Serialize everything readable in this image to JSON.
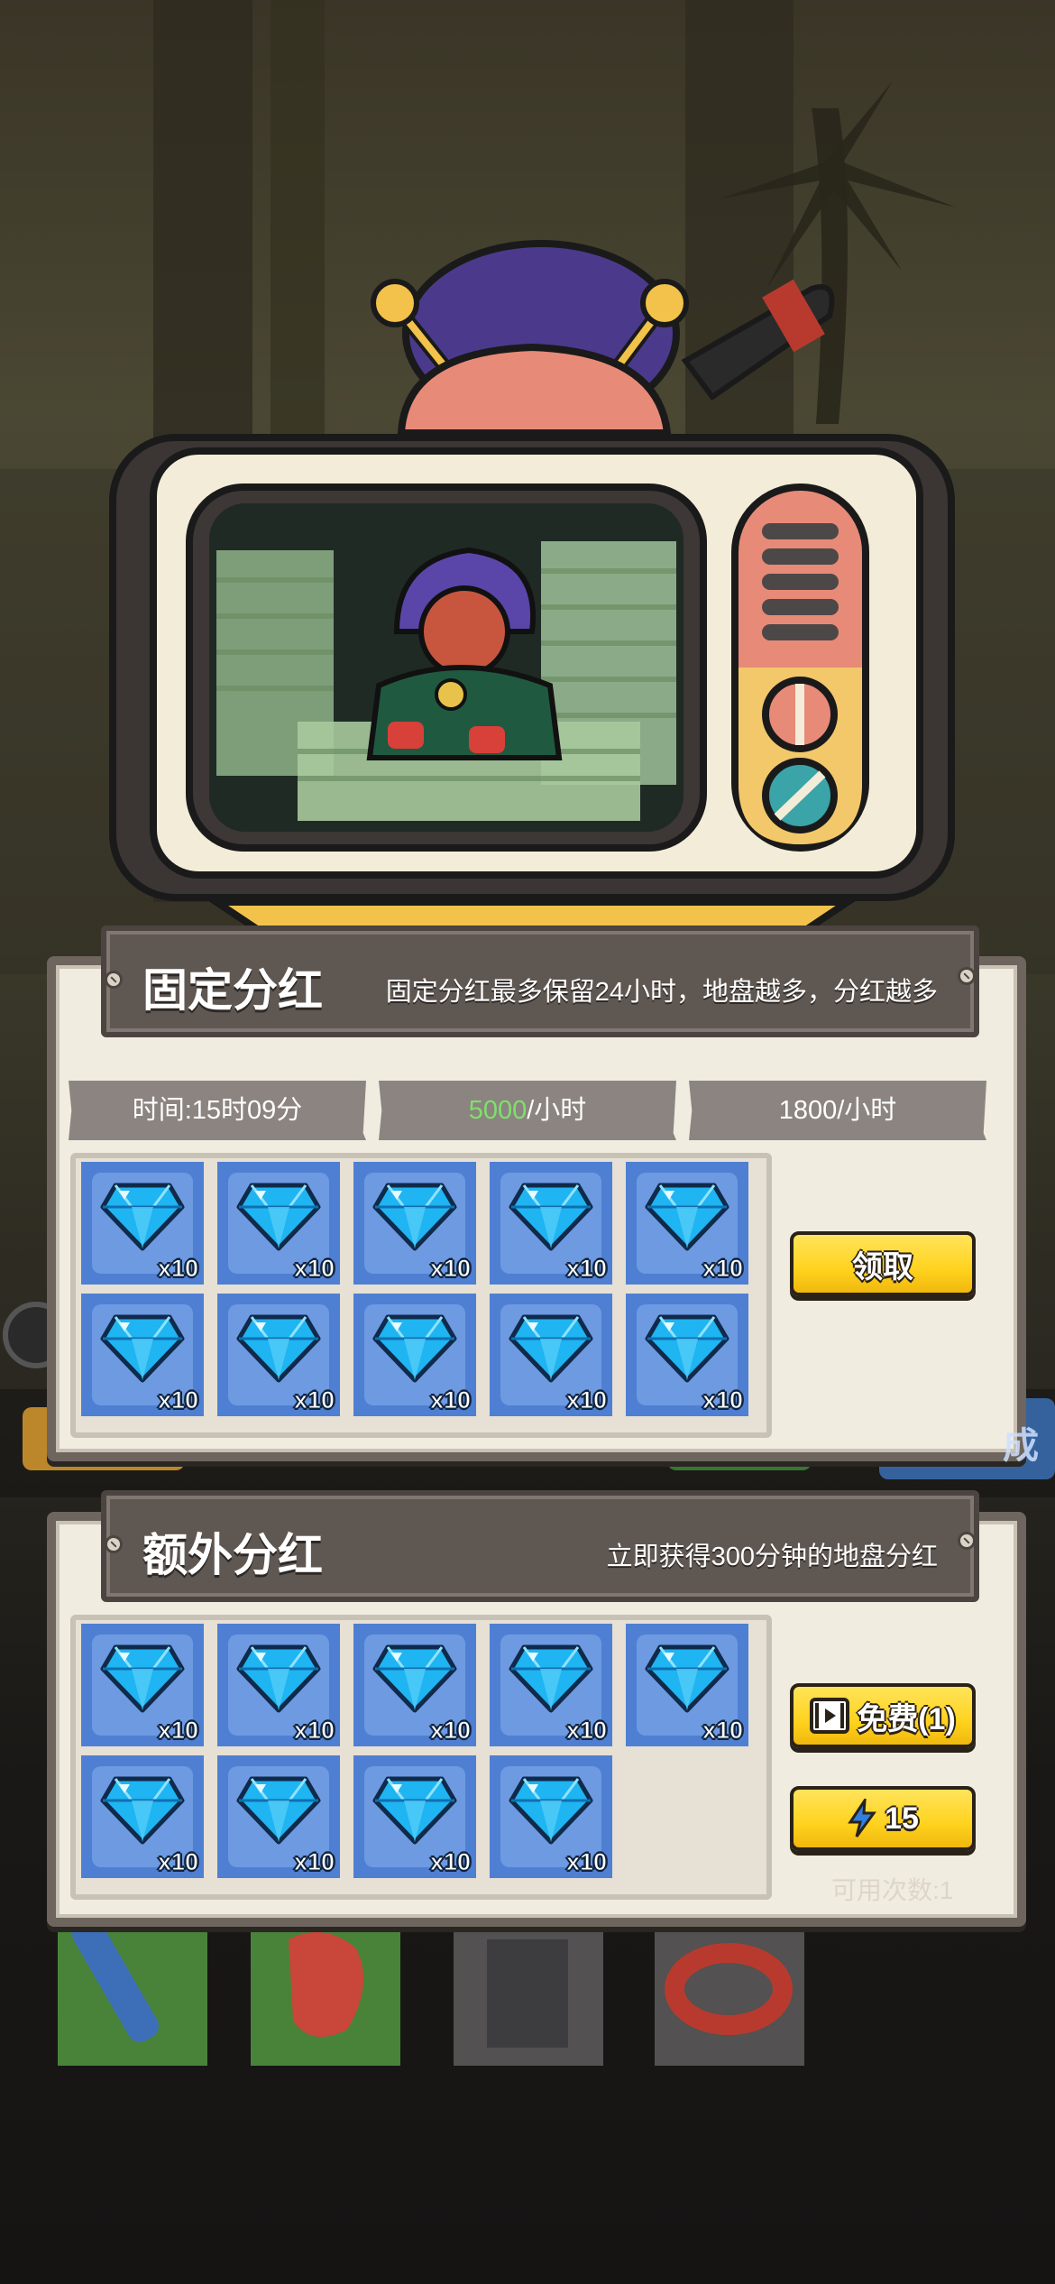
{
  "fixed_dividend": {
    "title": "固定分红",
    "description": "固定分红最多保留24小时，地盘越多，分红越多",
    "time_label": "时间:15时09分",
    "rate_value": "5000",
    "rate_unit": "/小时",
    "bonus_rate": "1800/小时",
    "rewards": [
      {
        "icon": "diamond-icon",
        "qty": "x10"
      },
      {
        "icon": "diamond-icon",
        "qty": "x10"
      },
      {
        "icon": "diamond-icon",
        "qty": "x10"
      },
      {
        "icon": "diamond-icon",
        "qty": "x10"
      },
      {
        "icon": "diamond-icon",
        "qty": "x10"
      },
      {
        "icon": "diamond-icon",
        "qty": "x10"
      },
      {
        "icon": "diamond-icon",
        "qty": "x10"
      },
      {
        "icon": "diamond-icon",
        "qty": "x10"
      },
      {
        "icon": "diamond-icon",
        "qty": "x10"
      },
      {
        "icon": "diamond-icon",
        "qty": "x10"
      }
    ],
    "claim_label": "领取"
  },
  "extra_dividend": {
    "title": "额外分红",
    "description": "立即获得300分钟的地盘分红",
    "rewards": [
      {
        "icon": "diamond-icon",
        "qty": "x10"
      },
      {
        "icon": "diamond-icon",
        "qty": "x10"
      },
      {
        "icon": "diamond-icon",
        "qty": "x10"
      },
      {
        "icon": "diamond-icon",
        "qty": "x10"
      },
      {
        "icon": "diamond-icon",
        "qty": "x10"
      },
      {
        "icon": "diamond-icon",
        "qty": "x10"
      },
      {
        "icon": "diamond-icon",
        "qty": "x10"
      },
      {
        "icon": "diamond-icon",
        "qty": "x10"
      },
      {
        "icon": "diamond-icon",
        "qty": "x10"
      }
    ],
    "free_label": "免费(1)",
    "energy_cost": "15",
    "remaining_label": "可用次数:1"
  },
  "background": {
    "right_tab_fragment": "成"
  },
  "colors": {
    "accent_yellow": "#ffd21e",
    "green_text": "#7ee16a",
    "panel_bg": "#f1ece0",
    "cell_blue": "#4f7fd2"
  }
}
